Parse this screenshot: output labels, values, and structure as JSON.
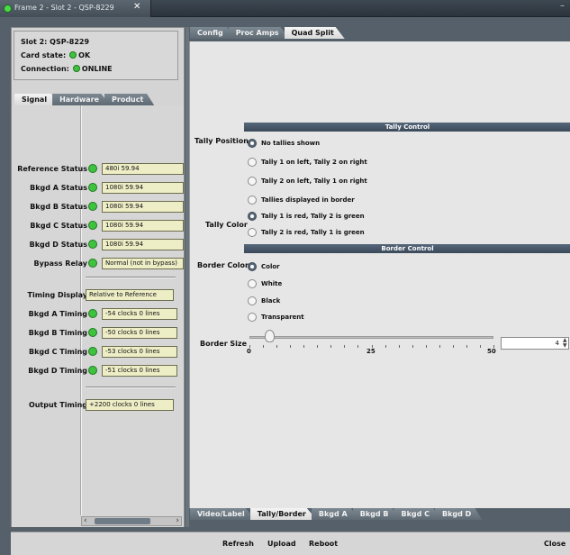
{
  "window": {
    "tab_title": "Frame 2 - Slot 2 - QSP-8229",
    "close_glyph": "✕",
    "minimize_glyph": "–"
  },
  "info": {
    "slot": "Slot 2: QSP-8229",
    "card_state_label": "Card state:",
    "card_state_value": "OK",
    "connection_label": "Connection:",
    "connection_value": "ONLINE"
  },
  "left_tabs": [
    {
      "label": "Signal",
      "active": true
    },
    {
      "label": "Hardware",
      "active": false
    },
    {
      "label": "Product",
      "active": false
    }
  ],
  "signal": {
    "status_rows": [
      {
        "label": "Reference Status",
        "value": "480i 59.94"
      },
      {
        "label": "Bkgd A Status",
        "value": "1080i 59.94"
      },
      {
        "label": "Bkgd B Status",
        "value": "1080i 59.94"
      },
      {
        "label": "Bkgd C Status",
        "value": "1080i 59.94"
      },
      {
        "label": "Bkgd D Status",
        "value": "1080i 59.94"
      },
      {
        "label": "Bypass Relay",
        "value": "Normal (not in bypass)"
      }
    ],
    "timing_display": {
      "label": "Timing Display",
      "value": "Relative to Reference"
    },
    "timing_rows": [
      {
        "label": "Bkgd A Timing",
        "value": "-54 clocks 0 lines"
      },
      {
        "label": "Bkgd B Timing",
        "value": "-50 clocks 0 lines"
      },
      {
        "label": "Bkgd C Timing",
        "value": "-53 clocks 0 lines"
      },
      {
        "label": "Bkgd D Timing",
        "value": "-51 clocks 0 lines"
      }
    ],
    "output_timing": {
      "label": "Output Timing",
      "value": "+2200 clocks 0 lines"
    }
  },
  "right_tabs": [
    {
      "label": "Config",
      "active": false
    },
    {
      "label": "Proc Amps",
      "active": false
    },
    {
      "label": "Quad Split",
      "active": true
    }
  ],
  "tally": {
    "section_title": "Tally Control",
    "position_label": "Tally Position",
    "position_options": [
      {
        "label": "No tallies shown",
        "selected": true
      },
      {
        "label": "Tally 1 on left, Tally 2 on right",
        "selected": false
      },
      {
        "label": "Tally 2 on left, Tally 1 on right",
        "selected": false
      },
      {
        "label": "Tallies displayed in border",
        "selected": false
      }
    ],
    "color_label": "Tally Color",
    "color_options": [
      {
        "label": "Tally 1 is red, Tally 2 is green",
        "selected": true
      },
      {
        "label": "Tally 2 is red, Tally 1 is green",
        "selected": false
      }
    ]
  },
  "border": {
    "section_title": "Border Control",
    "color_label": "Border Color",
    "color_options": [
      {
        "label": "Color",
        "selected": true
      },
      {
        "label": "White",
        "selected": false
      },
      {
        "label": "Black",
        "selected": false
      },
      {
        "label": "Transparent",
        "selected": false
      }
    ],
    "size_label": "Border Size",
    "size_value": "4",
    "slider_min": "0",
    "slider_mid": "25",
    "slider_max": "50",
    "slider_fraction": 0.08
  },
  "bottom_tabs": [
    {
      "label": "Video/Label",
      "active": false
    },
    {
      "label": "Tally/Border",
      "active": true
    },
    {
      "label": "Bkgd A",
      "active": false
    },
    {
      "label": "Bkgd B",
      "active": false
    },
    {
      "label": "Bkgd C",
      "active": false
    },
    {
      "label": "Bkgd D",
      "active": false
    }
  ],
  "footer": {
    "refresh": "Refresh",
    "upload": "Upload",
    "reboot": "Reboot",
    "close": "Close"
  },
  "colors": {
    "led_ok": "#3fc23f",
    "section_bar": "#4a5a6b",
    "field_bg": "#ededc6"
  }
}
